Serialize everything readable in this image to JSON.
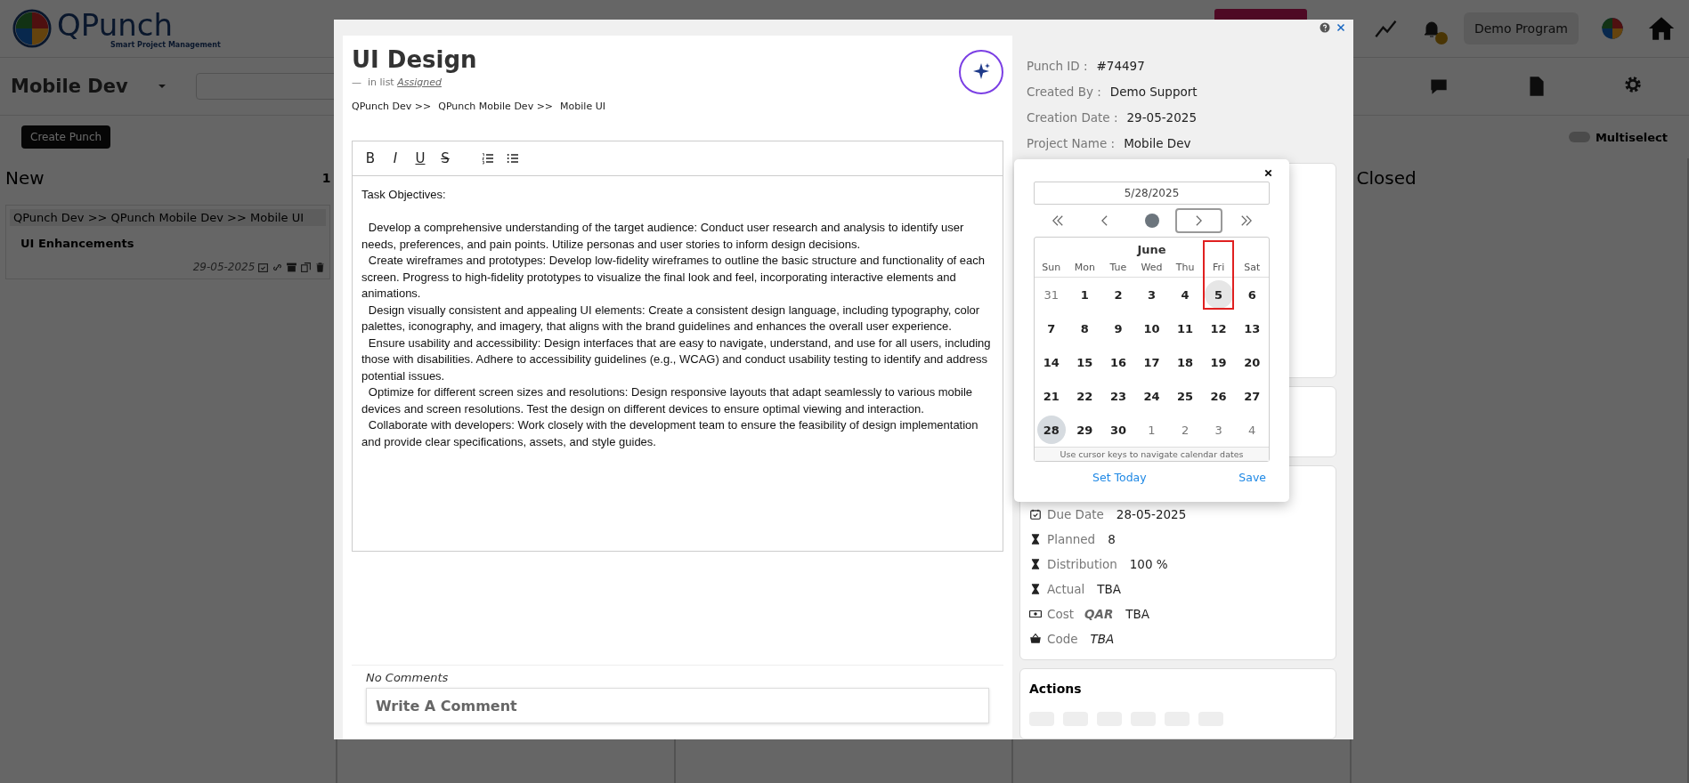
{
  "header": {
    "logo_title": "QPunch",
    "logo_subtitle": "Smart Project Management",
    "program_button": "Demo Program"
  },
  "toolbar": {
    "project": "Mobile Dev",
    "create_button": "Create Punch",
    "multiselect": {
      "label": "Multiselect",
      "on": false
    }
  },
  "columns": [
    {
      "title": "New",
      "count": "1",
      "cards": [
        {
          "path": "QPunch Dev >>  QPunch Mobile Dev >>  Mobile UI",
          "title": "UI Enhancements",
          "date": "29-05-2025"
        }
      ]
    },
    {},
    {},
    {},
    {
      "title": "Closed"
    }
  ],
  "modal": {
    "title": "UI Design",
    "list_dash": "—",
    "list_prefix": "in list",
    "list_name": "Assigned",
    "breadcrumb": [
      "QPunch Dev >>",
      "QPunch Mobile Dev >>",
      "Mobile UI"
    ],
    "editor_toolbar": [
      {
        "kind": "bold",
        "glyph": "B"
      },
      {
        "kind": "italic",
        "glyph": "I"
      },
      {
        "kind": "underline",
        "glyph": "U"
      },
      {
        "kind": "strike",
        "glyph": "S"
      },
      {
        "kind": "ordered-list"
      },
      {
        "kind": "bullet-list"
      }
    ],
    "content_heading": "Task Objectives:",
    "content": [
      "Develop a comprehensive understanding of the target audience: Conduct user research and analysis to identify user needs, preferences, and pain points. Utilize personas and user stories to inform design decisions.",
      "Create wireframes and prototypes: Develop low-fidelity wireframes to outline the basic structure and functionality of each screen. Progress to high-fidelity prototypes to visualize the final look and feel, incorporating interactive elements and animations.",
      "Design visually consistent and appealing UI elements: Create a consistent design language, including typography, color palettes, iconography, and imagery, that aligns with the brand guidelines and enhances the overall user experience.",
      "Ensure usability and accessibility: Design interfaces that are easy to navigate, understand, and use for all users, including those with disabilities. Adhere to accessibility guidelines (e.g., WCAG) and conduct usability testing to identify and address potential issues.",
      "Optimize for different screen sizes and resolutions: Design responsive layouts that adapt seamlessly to various mobile devices and screen resolutions. Test the design on different devices to ensure optimal viewing and interaction.",
      "Collaborate with developers: Work closely with the development team to ensure the feasibility of design implementation and provide clear specifications, assets, and style guides."
    ],
    "comments_status": "No Comments",
    "comment_field": {
      "placeholder": "Write A Comment"
    },
    "info": [
      {
        "label": "Punch ID :",
        "value": "#74497"
      },
      {
        "label": "Created By :",
        "value": "Demo Support"
      },
      {
        "label": "Creation Date :",
        "value": "29-05-2025"
      },
      {
        "label": "Project Name :",
        "value": "Mobile Dev"
      }
    ],
    "details": [
      {
        "kind": "due",
        "label": "Due Date",
        "value": "28-05-2025"
      },
      {
        "kind": "planned",
        "label": "Planned",
        "value": "8"
      },
      {
        "kind": "distribution",
        "label": "Distribution",
        "value": "100 %"
      },
      {
        "kind": "actual",
        "label": "Actual",
        "value": "TBA"
      },
      {
        "kind": "cost",
        "label": "Cost",
        "currency": "QAR",
        "value": "TBA"
      },
      {
        "kind": "code",
        "label": "Code",
        "value": "TBA"
      }
    ],
    "actions_title": "Actions",
    "datepicker": {
      "value": "5/28/2025",
      "nav": [
        {
          "kind": "first",
          "focused": false
        },
        {
          "kind": "prev",
          "focused": false
        },
        {
          "kind": "today",
          "focused": false
        },
        {
          "kind": "next",
          "focused": true
        },
        {
          "kind": "last",
          "focused": false
        }
      ],
      "month": "June",
      "weekdays": [
        "Sun",
        "Mon",
        "Tue",
        "Wed",
        "Thu",
        "Fri",
        "Sat"
      ],
      "days": [
        {
          "label": "31",
          "outside": true,
          "selected": false,
          "hovered": false,
          "marked": false
        },
        {
          "label": "1",
          "outside": false,
          "selected": false,
          "hovered": false,
          "marked": false
        },
        {
          "label": "2",
          "outside": false,
          "selected": false,
          "hovered": false,
          "marked": false
        },
        {
          "label": "3",
          "outside": false,
          "selected": false,
          "hovered": false,
          "marked": false
        },
        {
          "label": "4",
          "outside": false,
          "selected": false,
          "hovered": false,
          "marked": false
        },
        {
          "label": "5",
          "outside": false,
          "selected": false,
          "hovered": true,
          "marked": true
        },
        {
          "label": "6",
          "outside": false,
          "selected": false,
          "hovered": false,
          "marked": false
        },
        {
          "label": "7",
          "outside": false,
          "selected": false,
          "hovered": false,
          "marked": false
        },
        {
          "label": "8",
          "outside": false,
          "selected": false,
          "hovered": false,
          "marked": false
        },
        {
          "label": "9",
          "outside": false,
          "selected": false,
          "hovered": false,
          "marked": false
        },
        {
          "label": "10",
          "outside": false,
          "selected": false,
          "hovered": false,
          "marked": false
        },
        {
          "label": "11",
          "outside": false,
          "selected": false,
          "hovered": false,
          "marked": false
        },
        {
          "label": "12",
          "outside": false,
          "selected": false,
          "hovered": false,
          "marked": false
        },
        {
          "label": "13",
          "outside": false,
          "selected": false,
          "hovered": false,
          "marked": false
        },
        {
          "label": "14",
          "outside": false,
          "selected": false,
          "hovered": false,
          "marked": false
        },
        {
          "label": "15",
          "outside": false,
          "selected": false,
          "hovered": false,
          "marked": false
        },
        {
          "label": "16",
          "outside": false,
          "selected": false,
          "hovered": false,
          "marked": false
        },
        {
          "label": "17",
          "outside": false,
          "selected": false,
          "hovered": false,
          "marked": false
        },
        {
          "label": "18",
          "outside": false,
          "selected": false,
          "hovered": false,
          "marked": false
        },
        {
          "label": "19",
          "outside": false,
          "selected": false,
          "hovered": false,
          "marked": false
        },
        {
          "label": "20",
          "outside": false,
          "selected": false,
          "hovered": false,
          "marked": false
        },
        {
          "label": "21",
          "outside": false,
          "selected": false,
          "hovered": false,
          "marked": false
        },
        {
          "label": "22",
          "outside": false,
          "selected": false,
          "hovered": false,
          "marked": false
        },
        {
          "label": "23",
          "outside": false,
          "selected": false,
          "hovered": false,
          "marked": false
        },
        {
          "label": "24",
          "outside": false,
          "selected": false,
          "hovered": false,
          "marked": false
        },
        {
          "label": "25",
          "outside": false,
          "selected": false,
          "hovered": false,
          "marked": false
        },
        {
          "label": "26",
          "outside": false,
          "selected": false,
          "hovered": false,
          "marked": false
        },
        {
          "label": "27",
          "outside": false,
          "selected": false,
          "hovered": false,
          "marked": false
        },
        {
          "label": "28",
          "outside": false,
          "selected": true,
          "hovered": false,
          "marked": false
        },
        {
          "label": "29",
          "outside": false,
          "selected": false,
          "hovered": false,
          "marked": false
        },
        {
          "label": "30",
          "outside": false,
          "selected": false,
          "hovered": false,
          "marked": false
        },
        {
          "label": "1",
          "outside": true,
          "selected": false,
          "hovered": false,
          "marked": false
        },
        {
          "label": "2",
          "outside": true,
          "selected": false,
          "hovered": false,
          "marked": false
        },
        {
          "label": "3",
          "outside": true,
          "selected": false,
          "hovered": false,
          "marked": false
        },
        {
          "label": "4",
          "outside": true,
          "selected": false,
          "hovered": false,
          "marked": false
        }
      ],
      "hint": "Use cursor keys to navigate calendar dates",
      "set_today_button": "Set Today",
      "save_button": "Save"
    }
  }
}
